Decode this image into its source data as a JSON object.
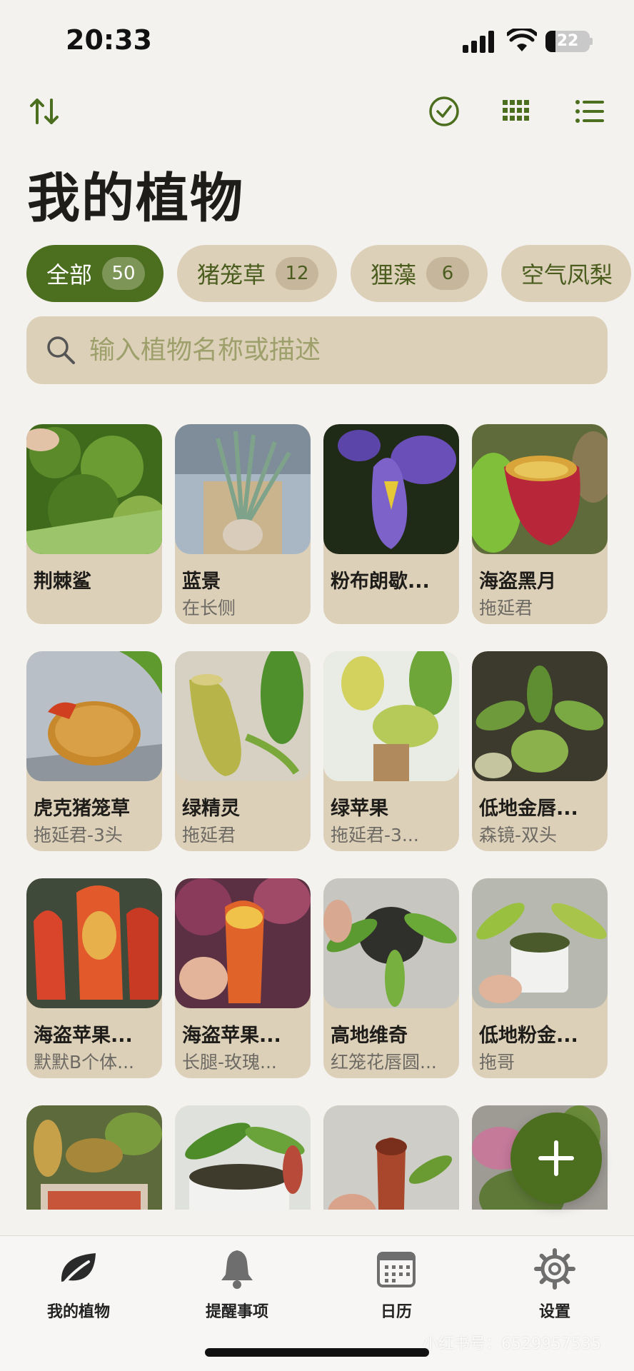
{
  "status_bar": {
    "time": "20:33",
    "battery": "22",
    "battery_fraction": 0.22
  },
  "page_title": "我的植物",
  "filters": [
    {
      "label": "全部",
      "count": "50",
      "active": true
    },
    {
      "label": "猪笼草",
      "count": "12",
      "active": false
    },
    {
      "label": "狸藻",
      "count": "6",
      "active": false
    },
    {
      "label": "空气凤梨",
      "count": "",
      "active": false
    }
  ],
  "search": {
    "placeholder": "输入植物名称或描述",
    "value": ""
  },
  "plants": [
    {
      "name": "荆棘鲨",
      "sub": ""
    },
    {
      "name": "蓝景",
      "sub": "在长侧"
    },
    {
      "name": "粉布朗歇...",
      "sub": ""
    },
    {
      "name": "海盗黑月",
      "sub": "拖延君"
    },
    {
      "name": "虎克猪笼草",
      "sub": "拖延君-3头"
    },
    {
      "name": "绿精灵",
      "sub": "拖延君"
    },
    {
      "name": "绿苹果",
      "sub": "拖延君-3..."
    },
    {
      "name": "低地金唇...",
      "sub": "森镜-双头"
    },
    {
      "name": "海盗苹果...",
      "sub": "默默B个体..."
    },
    {
      "name": "海盗苹果...",
      "sub": "长腿-玫瑰..."
    },
    {
      "name": "高地维奇",
      "sub": "红笼花唇圆..."
    },
    {
      "name": "低地粉金...",
      "sub": "拖哥"
    },
    {
      "name": "",
      "sub": ""
    },
    {
      "name": "",
      "sub": ""
    },
    {
      "name": "",
      "sub": ""
    },
    {
      "name": "",
      "sub": ""
    }
  ],
  "tabs": [
    {
      "label": "我的植物",
      "icon": "leaf-icon"
    },
    {
      "label": "提醒事项",
      "icon": "bell-icon"
    },
    {
      "label": "日历",
      "icon": "calendar-icon"
    },
    {
      "label": "设置",
      "icon": "gear-icon"
    }
  ],
  "watermark": "小红书号：6529957535",
  "colors": {
    "accent": "#4c6e1f",
    "chip": "#ddd0b9",
    "background": "#f3f2ee"
  }
}
